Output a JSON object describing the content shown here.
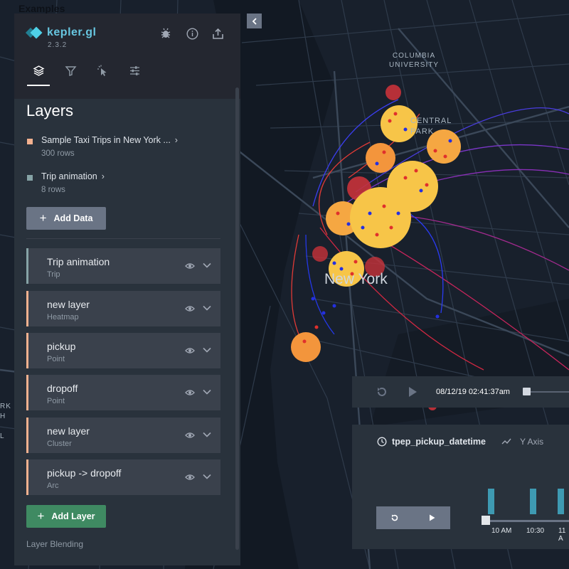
{
  "map": {
    "labels": {
      "columbia": "COLUMBIA\nUNIVERSITY",
      "central_park": "CENTRAL\nPARK",
      "new_york": "New York",
      "side_text": "RK\nH\n\nL"
    }
  },
  "examples_label": "Examples",
  "app": {
    "name": "kepler.gl",
    "version": "2.3.2"
  },
  "sidebar": {
    "title": "Layers",
    "datasets": [
      {
        "name": "Sample Taxi Trips in New York ...",
        "rows": "300 rows",
        "color": "#f3b18f"
      },
      {
        "name": "Trip animation",
        "rows": "8 rows",
        "color": "#86a3a6"
      }
    ],
    "add_data_label": "Add Data",
    "layers": [
      {
        "name": "Trip animation",
        "type": "Trip",
        "color": "#86a3a6"
      },
      {
        "name": "new layer",
        "type": "Heatmap",
        "color": "#f3b18f"
      },
      {
        "name": "pickup",
        "type": "Point",
        "color": "#f3b18f"
      },
      {
        "name": "dropoff",
        "type": "Point",
        "color": "#f3b18f"
      },
      {
        "name": "new layer",
        "type": "Cluster",
        "color": "#f3b18f"
      },
      {
        "name": "pickup -> dropoff",
        "type": "Arc",
        "color": "#f3b18f"
      }
    ],
    "add_layer_label": "Add Layer",
    "layer_blending_label": "Layer Blending"
  },
  "time_player": {
    "time": "08/12/19 02:41:37am",
    "progress": 0
  },
  "filter": {
    "field": "tpep_pickup_datetime",
    "y_axis": "Y Axis",
    "ticks": [
      "10 AM",
      "10:30",
      "11 A"
    ]
  },
  "colors": {
    "accent": "#1fbad6",
    "add_layer": "#3f8a62",
    "panel": "#29323c"
  }
}
